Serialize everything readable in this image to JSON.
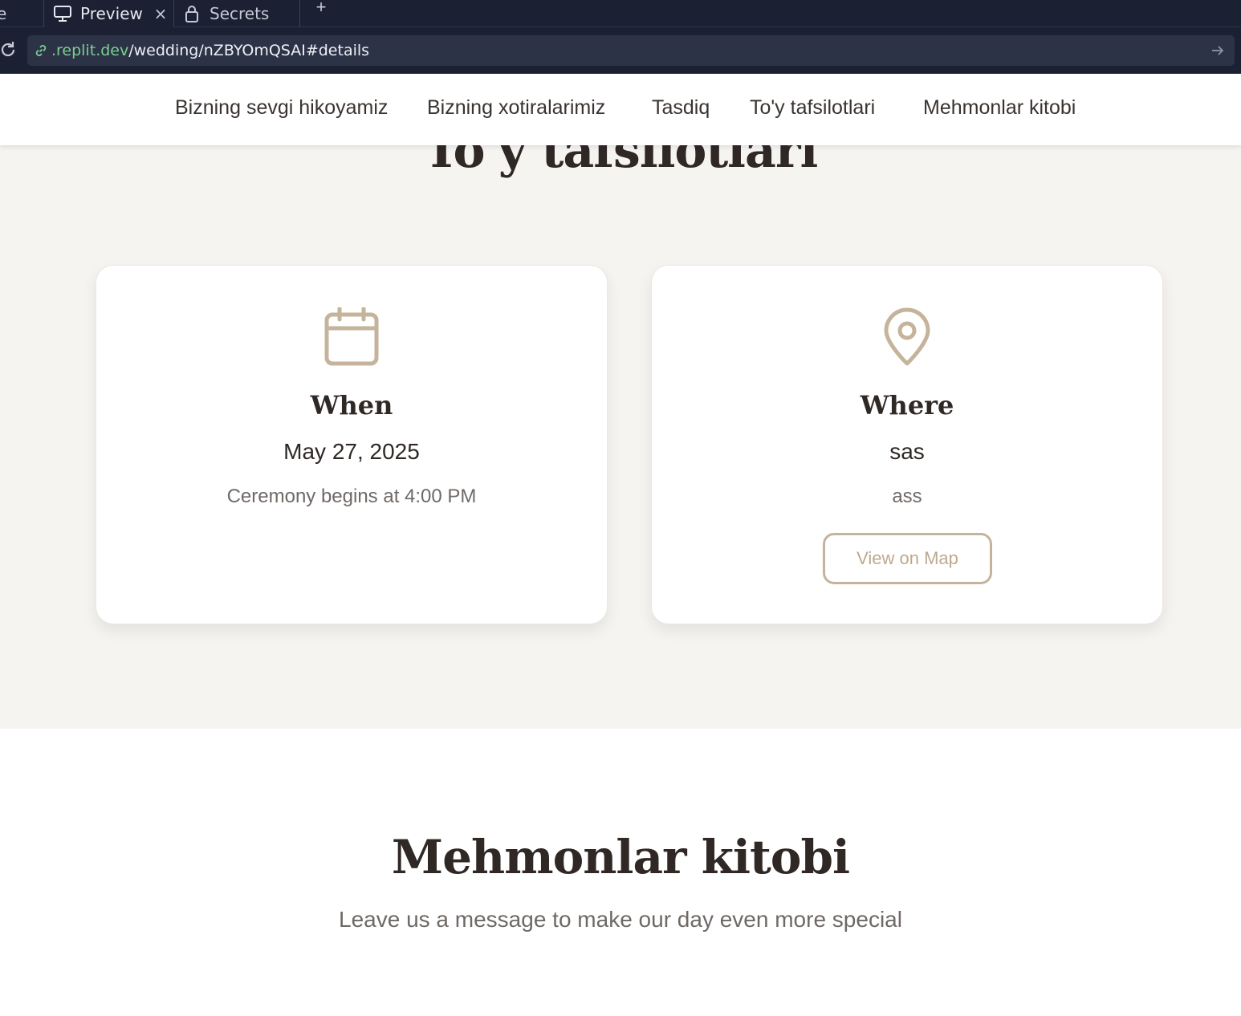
{
  "browser": {
    "tabs": [
      {
        "label": "e"
      },
      {
        "label": "Preview",
        "close": "×"
      },
      {
        "label": "Secrets"
      }
    ],
    "new_tab": "+",
    "url": {
      "domain": ".replit.dev",
      "path": "/wedding/nZBYOmQSAI#details"
    }
  },
  "nav": {
    "items": [
      {
        "label": "Bizning sevgi hikoyamiz"
      },
      {
        "label": "Bizning xotiralarimiz"
      },
      {
        "label": "Tasdiq"
      },
      {
        "label": "To'y tafsilotlari"
      },
      {
        "label": "Mehmonlar kitobi"
      }
    ]
  },
  "details": {
    "title": "To'y tafsilotlari",
    "when": {
      "heading": "When",
      "date": "May 27, 2025",
      "time": "Ceremony begins at 4:00 PM",
      "icon": "calendar-icon"
    },
    "where": {
      "heading": "Where",
      "venue": "sas",
      "address": "ass",
      "button": "View on Map",
      "icon": "map-pin-icon"
    }
  },
  "guestbook": {
    "title": "Mehmonlar kitobi",
    "subtitle": "Leave us a message to make our day even more special"
  },
  "colors": {
    "chrome_bg": "#1b2033",
    "url_bg": "#2c3347",
    "domain_green": "#7ccf8f",
    "accent": "#c5b49b",
    "section_bg": "#f6f4f1",
    "heading_text": "#2f2825"
  }
}
